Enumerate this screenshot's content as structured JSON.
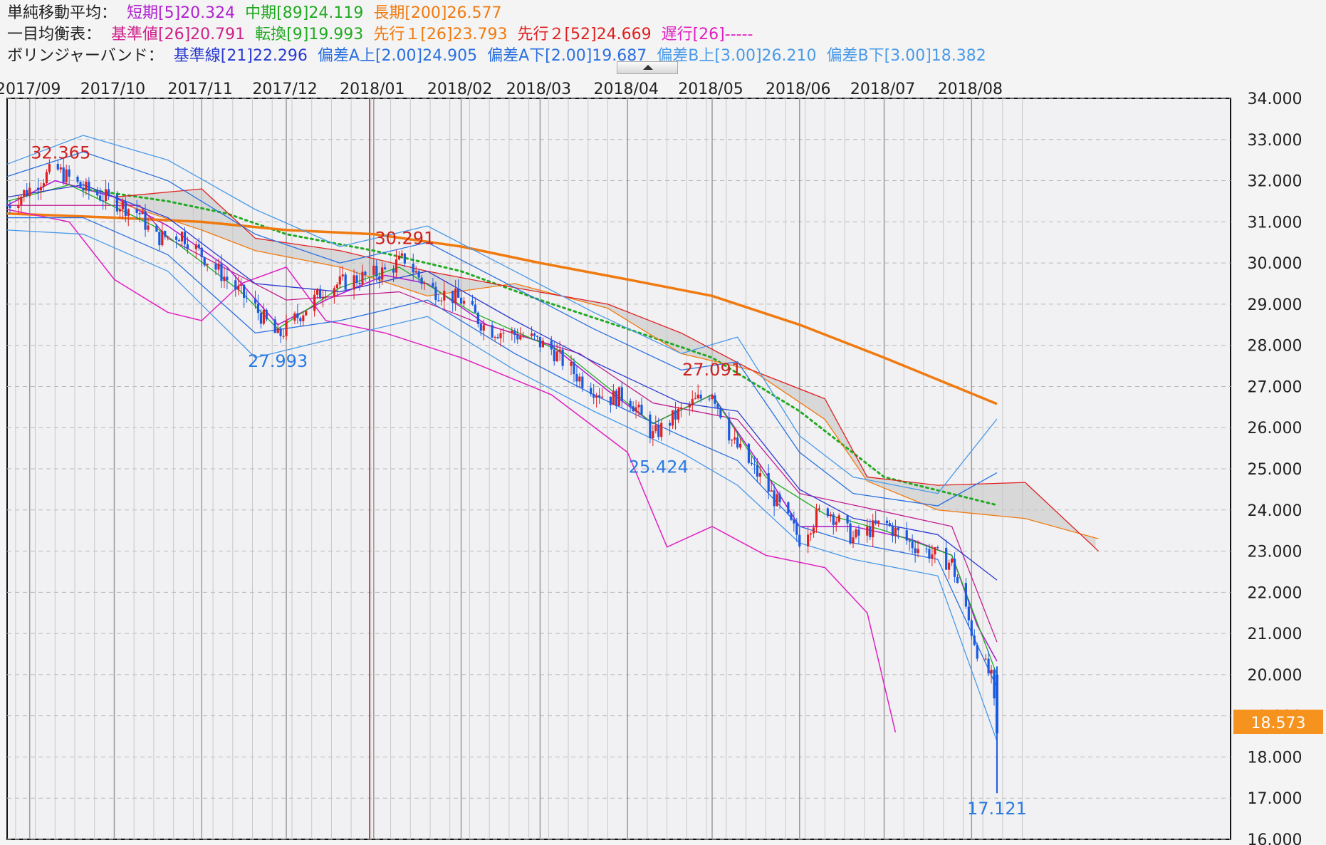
{
  "legend": {
    "sma": {
      "title": "単純移動平均：",
      "short": "短期[5]20.324",
      "mid": "中期[89]24.119",
      "long": "長期[200]26.577"
    },
    "ichimoku": {
      "title": "一目均衡表：",
      "kijun": "基準値[26]20.791",
      "tenkan": "転換[9]19.993",
      "senko1": "先行１[26]23.793",
      "senko2": "先行２[52]24.669",
      "chikou": "遅行[26]-----"
    },
    "bollinger": {
      "title": "ボリンジャーバンド：",
      "base": "基準線[21]22.296",
      "a_upper": "偏差A上[2.00]24.905",
      "a_lower": "偏差A下[2.00]19.687",
      "b_upper": "偏差B上[3.00]26.210",
      "b_lower": "偏差B下[3.00]18.382"
    }
  },
  "colors": {
    "sma_short": "#b020d0",
    "sma_mid": "#22aa22",
    "sma_long": "#f07a10",
    "ichimoku_label": "#d0208a",
    "kijun": "#c02090",
    "tenkan": "#22aa22",
    "senko1": "#f07a10",
    "senko2": "#e02020",
    "chikou": "#e020c0",
    "bb_base": "#2a3ad0",
    "bb_a": "#2a70e0",
    "bb_b": "#4a9ae8",
    "candle_up": "#e02020",
    "candle_down": "#1a5ae0",
    "price_tag": "#f6921e"
  },
  "chart_data": {
    "type": "candlestick",
    "x_month_labels": [
      "2017/09",
      "2017/10",
      "2017/11",
      "2017/12",
      "2018/01",
      "2018/02",
      "2018/03",
      "2018/04",
      "2018/05",
      "2018/06",
      "2018/07",
      "2018/08"
    ],
    "y_ticks": [
      "34.000",
      "33.000",
      "32.000",
      "31.000",
      "30.000",
      "29.000",
      "28.000",
      "27.000",
      "26.000",
      "25.000",
      "24.000",
      "23.000",
      "22.000",
      "21.000",
      "20.000",
      "19.000",
      "18.000",
      "17.000",
      "16.000"
    ],
    "ylim": [
      16,
      34
    ],
    "grid": true,
    "current_price": "18.573",
    "current_price_value": 18.573,
    "annotations": [
      {
        "text": "32.365",
        "value": 32.365,
        "kind": "high",
        "date": "2017/09"
      },
      {
        "text": "27.993",
        "value": 27.993,
        "kind": "low",
        "date": "2017/11"
      },
      {
        "text": "30.291",
        "value": 30.291,
        "kind": "high",
        "date": "2018/01"
      },
      {
        "text": "25.424",
        "value": 25.424,
        "kind": "low",
        "date": "2018/04"
      },
      {
        "text": "27.091",
        "value": 27.091,
        "kind": "high",
        "date": "2018/05"
      },
      {
        "text": "17.121",
        "value": 17.121,
        "kind": "low",
        "date": "2018/08"
      }
    ],
    "close_path": [
      [
        "2017/08/24",
        31.4
      ],
      [
        "2017/09/01",
        31.8
      ],
      [
        "2017/09/10",
        32.3
      ],
      [
        "2017/09/20",
        31.8
      ],
      [
        "2017/10/01",
        31.5
      ],
      [
        "2017/10/10",
        31.2
      ],
      [
        "2017/10/15",
        30.6
      ],
      [
        "2017/10/25",
        30.7
      ],
      [
        "2017/11/01",
        30.2
      ],
      [
        "2017/11/10",
        29.6
      ],
      [
        "2017/11/20",
        28.9
      ],
      [
        "2017/11/28",
        28.2
      ],
      [
        "2017/12/05",
        28.7
      ],
      [
        "2017/12/15",
        29.4
      ],
      [
        "2017/12/25",
        29.6
      ],
      [
        "2018/01/05",
        29.8
      ],
      [
        "2018/01/12",
        30.1
      ],
      [
        "2018/01/20",
        29.4
      ],
      [
        "2018/02/01",
        29.1
      ],
      [
        "2018/02/10",
        28.4
      ],
      [
        "2018/02/25",
        28.2
      ],
      [
        "2018/03/05",
        27.9
      ],
      [
        "2018/03/15",
        27.2
      ],
      [
        "2018/03/25",
        26.7
      ],
      [
        "2018/04/01",
        26.8
      ],
      [
        "2018/04/10",
        25.8
      ],
      [
        "2018/04/20",
        26.4
      ],
      [
        "2018/05/01",
        26.9
      ],
      [
        "2018/05/08",
        25.7
      ],
      [
        "2018/05/20",
        24.6
      ],
      [
        "2018/06/01",
        23.3
      ],
      [
        "2018/06/10",
        24.1
      ],
      [
        "2018/06/20",
        23.3
      ],
      [
        "2018/07/01",
        23.7
      ],
      [
        "2018/07/10",
        23.2
      ],
      [
        "2018/07/25",
        22.7
      ],
      [
        "2018/08/03",
        20.6
      ],
      [
        "2018/08/08",
        19.9
      ],
      [
        "2018/08/10",
        18.573
      ]
    ],
    "series": [
      {
        "name": "短期[5]",
        "key": "sma_short",
        "points": [
          [
            "2017/08/24",
            31.4
          ],
          [
            "2017/09/10",
            32.0
          ],
          [
            "2017/10/01",
            31.6
          ],
          [
            "2017/10/20",
            30.9
          ],
          [
            "2017/11/10",
            29.9
          ],
          [
            "2017/11/28",
            28.5
          ],
          [
            "2017/12/15",
            29.1
          ],
          [
            "2018/01/05",
            29.7
          ],
          [
            "2018/01/20",
            29.5
          ],
          [
            "2018/02/10",
            28.5
          ],
          [
            "2018/03/05",
            28.0
          ],
          [
            "2018/03/25",
            26.9
          ],
          [
            "2018/04/10",
            26.1
          ],
          [
            "2018/05/01",
            26.8
          ],
          [
            "2018/05/20",
            24.9
          ],
          [
            "2018/06/01",
            23.6
          ],
          [
            "2018/06/20",
            23.6
          ],
          [
            "2018/07/10",
            23.3
          ],
          [
            "2018/07/25",
            22.9
          ],
          [
            "2018/08/03",
            21.2
          ],
          [
            "2018/08/10",
            20.324
          ]
        ]
      },
      {
        "name": "中期[89]",
        "key": "sma_mid",
        "style": "dotted",
        "points": [
          [
            "2017/09/20",
            31.8
          ],
          [
            "2017/10/20",
            31.5
          ],
          [
            "2017/11/10",
            31.2
          ],
          [
            "2017/12/01",
            30.7
          ],
          [
            "2018/01/01",
            30.3
          ],
          [
            "2018/02/01",
            29.8
          ],
          [
            "2018/03/01",
            29.1
          ],
          [
            "2018/04/01",
            28.4
          ],
          [
            "2018/05/01",
            27.7
          ],
          [
            "2018/06/01",
            26.4
          ],
          [
            "2018/07/01",
            24.8
          ],
          [
            "2018/08/10",
            24.119
          ]
        ]
      },
      {
        "name": "長期[200]",
        "key": "sma_long",
        "points": [
          [
            "2017/08/24",
            31.2
          ],
          [
            "2017/10/01",
            31.1
          ],
          [
            "2017/11/01",
            31.0
          ],
          [
            "2017/12/01",
            30.8
          ],
          [
            "2018/01/01",
            30.7
          ],
          [
            "2018/02/01",
            30.4
          ],
          [
            "2018/03/01",
            30.0
          ],
          [
            "2018/04/01",
            29.6
          ],
          [
            "2018/05/01",
            29.2
          ],
          [
            "2018/06/01",
            28.5
          ],
          [
            "2018/07/01",
            27.7
          ],
          [
            "2018/08/10",
            26.577
          ]
        ]
      },
      {
        "name": "基準値[26]",
        "key": "kijun",
        "points": [
          [
            "2017/08/24",
            31.4
          ],
          [
            "2017/10/10",
            31.4
          ],
          [
            "2017/10/20",
            30.6
          ],
          [
            "2017/12/01",
            29.1
          ],
          [
            "2018/01/10",
            29.3
          ],
          [
            "2018/02/05",
            28.6
          ],
          [
            "2018/03/15",
            27.8
          ],
          [
            "2018/04/10",
            26.6
          ],
          [
            "2018/05/10",
            26.2
          ],
          [
            "2018/06/01",
            24.4
          ],
          [
            "2018/07/05",
            23.9
          ],
          [
            "2018/07/25",
            23.6
          ],
          [
            "2018/08/10",
            20.791
          ]
        ]
      },
      {
        "name": "転換[9]",
        "key": "tenkan",
        "points": [
          [
            "2017/08/24",
            31.5
          ],
          [
            "2017/09/15",
            31.9
          ],
          [
            "2017/10/15",
            30.9
          ],
          [
            "2017/11/15",
            29.3
          ],
          [
            "2017/11/28",
            28.4
          ],
          [
            "2017/12/20",
            29.4
          ],
          [
            "2018/01/10",
            29.9
          ],
          [
            "2018/02/05",
            28.8
          ],
          [
            "2018/03/10",
            27.8
          ],
          [
            "2018/04/10",
            26.1
          ],
          [
            "2018/05/01",
            26.8
          ],
          [
            "2018/05/20",
            24.8
          ],
          [
            "2018/06/10",
            23.9
          ],
          [
            "2018/07/01",
            23.5
          ],
          [
            "2018/07/25",
            22.9
          ],
          [
            "2018/08/10",
            19.993
          ]
        ]
      },
      {
        "name": "先行１[26]",
        "key": "senko1",
        "points": [
          [
            "2017/10/01",
            31.5
          ],
          [
            "2017/11/01",
            30.8
          ],
          [
            "2017/11/20",
            30.3
          ],
          [
            "2017/12/20",
            29.9
          ],
          [
            "2018/01/20",
            29.2
          ],
          [
            "2018/02/20",
            29.5
          ],
          [
            "2018/03/25",
            28.9
          ],
          [
            "2018/04/20",
            27.8
          ],
          [
            "2018/05/15",
            27.4
          ],
          [
            "2018/06/10",
            26.2
          ],
          [
            "2018/06/25",
            24.7
          ],
          [
            "2018/07/20",
            24.0
          ],
          [
            "2018/08/20",
            23.793
          ],
          [
            "2018/09/15",
            23.3
          ]
        ]
      },
      {
        "name": "先行２[52]",
        "key": "senko2",
        "points": [
          [
            "2017/10/01",
            31.6
          ],
          [
            "2017/11/01",
            31.8
          ],
          [
            "2017/11/20",
            30.6
          ],
          [
            "2017/12/20",
            30.3
          ],
          [
            "2018/01/20",
            29.8
          ],
          [
            "2018/02/20",
            29.4
          ],
          [
            "2018/03/25",
            29.0
          ],
          [
            "2018/04/20",
            28.3
          ],
          [
            "2018/05/15",
            27.4
          ],
          [
            "2018/06/10",
            26.7
          ],
          [
            "2018/06/25",
            24.8
          ],
          [
            "2018/07/20",
            24.6
          ],
          [
            "2018/08/20",
            24.669
          ],
          [
            "2018/09/15",
            23.0
          ]
        ]
      },
      {
        "name": "遅行[26]",
        "key": "chikou",
        "points": [
          [
            "2017/08/24",
            31.3
          ],
          [
            "2017/09/15",
            31.0
          ],
          [
            "2017/10/01",
            29.6
          ],
          [
            "2017/10/20",
            28.8
          ],
          [
            "2017/11/01",
            28.6
          ],
          [
            "2017/11/15",
            29.5
          ],
          [
            "2017/12/01",
            29.9
          ],
          [
            "2017/12/15",
            28.6
          ],
          [
            "2018/01/05",
            28.3
          ],
          [
            "2018/02/01",
            27.7
          ],
          [
            "2018/03/05",
            26.8
          ],
          [
            "2018/04/01",
            25.4
          ],
          [
            "2018/04/15",
            23.1
          ],
          [
            "2018/05/01",
            23.6
          ],
          [
            "2018/05/20",
            22.9
          ],
          [
            "2018/06/10",
            22.6
          ],
          [
            "2018/06/25",
            21.5
          ],
          [
            "2018/07/05",
            18.6
          ]
        ]
      },
      {
        "name": "基準線[21]",
        "key": "bb_base",
        "points": [
          [
            "2017/08/24",
            31.6
          ],
          [
            "2017/09/20",
            31.9
          ],
          [
            "2017/10/20",
            31.1
          ],
          [
            "2017/11/20",
            29.5
          ],
          [
            "2017/12/20",
            29.3
          ],
          [
            "2018/01/20",
            29.8
          ],
          [
            "2018/02/20",
            28.6
          ],
          [
            "2018/03/20",
            27.6
          ],
          [
            "2018/04/20",
            26.6
          ],
          [
            "2018/05/10",
            26.4
          ],
          [
            "2018/06/01",
            24.5
          ],
          [
            "2018/06/20",
            23.8
          ],
          [
            "2018/07/20",
            23.4
          ],
          [
            "2018/08/10",
            22.296
          ]
        ]
      },
      {
        "name": "偏差A上[2.00]",
        "key": "bb_a_upper",
        "points": [
          [
            "2017/08/24",
            32.1
          ],
          [
            "2017/09/20",
            32.7
          ],
          [
            "2017/10/20",
            32.0
          ],
          [
            "2017/11/20",
            30.7
          ],
          [
            "2017/12/20",
            30.0
          ],
          [
            "2018/01/20",
            30.5
          ],
          [
            "2018/02/20",
            29.4
          ],
          [
            "2018/03/20",
            28.4
          ],
          [
            "2018/04/20",
            27.4
          ],
          [
            "2018/05/10",
            27.6
          ],
          [
            "2018/06/01",
            25.4
          ],
          [
            "2018/06/20",
            24.4
          ],
          [
            "2018/07/20",
            24.1
          ],
          [
            "2018/08/10",
            24.905
          ]
        ]
      },
      {
        "name": "偏差A下[2.00]",
        "key": "bb_a_lower",
        "points": [
          [
            "2017/08/24",
            31.1
          ],
          [
            "2017/09/20",
            31.1
          ],
          [
            "2017/10/20",
            30.2
          ],
          [
            "2017/11/20",
            28.3
          ],
          [
            "2017/12/20",
            28.6
          ],
          [
            "2018/01/20",
            29.1
          ],
          [
            "2018/02/20",
            27.8
          ],
          [
            "2018/03/20",
            26.8
          ],
          [
            "2018/04/20",
            25.8
          ],
          [
            "2018/05/10",
            25.2
          ],
          [
            "2018/06/01",
            23.6
          ],
          [
            "2018/06/20",
            23.2
          ],
          [
            "2018/07/20",
            22.8
          ],
          [
            "2018/08/10",
            19.687
          ]
        ]
      },
      {
        "name": "偏差B上[3.00]",
        "key": "bb_b_upper",
        "points": [
          [
            "2017/08/24",
            32.4
          ],
          [
            "2017/09/20",
            33.1
          ],
          [
            "2017/10/20",
            32.5
          ],
          [
            "2017/11/20",
            31.3
          ],
          [
            "2017/12/20",
            30.4
          ],
          [
            "2018/01/20",
            30.9
          ],
          [
            "2018/02/20",
            29.8
          ],
          [
            "2018/03/20",
            28.8
          ],
          [
            "2018/04/20",
            27.8
          ],
          [
            "2018/05/10",
            28.2
          ],
          [
            "2018/06/01",
            25.8
          ],
          [
            "2018/06/20",
            24.8
          ],
          [
            "2018/07/20",
            24.4
          ],
          [
            "2018/08/10",
            26.21
          ]
        ]
      },
      {
        "name": "偏差B下[3.00]",
        "key": "bb_b_lower",
        "points": [
          [
            "2017/08/24",
            30.8
          ],
          [
            "2017/09/20",
            30.7
          ],
          [
            "2017/10/20",
            29.8
          ],
          [
            "2017/11/20",
            27.7
          ],
          [
            "2017/12/20",
            28.2
          ],
          [
            "2018/01/20",
            28.7
          ],
          [
            "2018/02/20",
            27.4
          ],
          [
            "2018/03/20",
            26.4
          ],
          [
            "2018/04/20",
            25.4
          ],
          [
            "2018/05/10",
            24.6
          ],
          [
            "2018/06/01",
            23.2
          ],
          [
            "2018/06/20",
            22.8
          ],
          [
            "2018/07/20",
            22.4
          ],
          [
            "2018/08/10",
            18.382
          ]
        ]
      }
    ]
  }
}
